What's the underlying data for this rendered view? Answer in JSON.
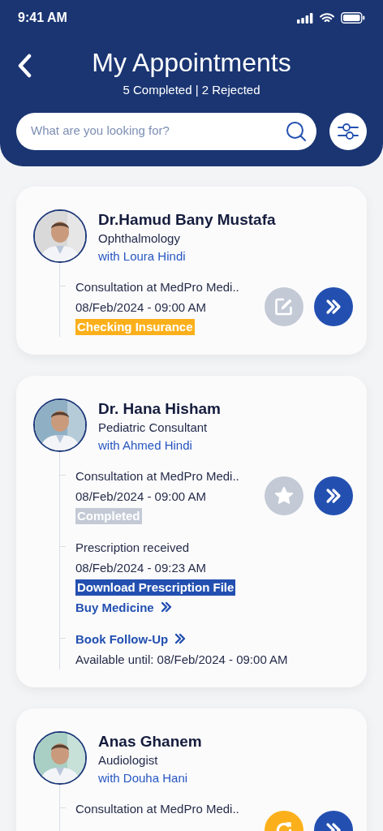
{
  "status_bar": {
    "time": "9:41 AM"
  },
  "header": {
    "title": "My Appointments",
    "subtitle": "5 Completed | 2 Rejected",
    "search": {
      "placeholder": "What are you looking for?"
    }
  },
  "appointments": [
    {
      "doctor": "Dr.Hamud Bany Mustafa",
      "specialty": "Ophthalmology",
      "with": "with Loura Hindi",
      "photo": {
        "kind": "picture"
      },
      "actions": [
        {
          "kind": "edit",
          "color": "#c3cad6"
        },
        {
          "kind": "next",
          "color": "#2350b0"
        }
      ],
      "events": [
        {
          "kind": "visit",
          "place": "Consultation at MedPro Medi..",
          "datetime": "08/Feb/2024 - 09:00 AM",
          "status": {
            "label": "Checking Insurance",
            "color": "#fbb01b"
          }
        }
      ]
    },
    {
      "doctor": "Dr. Hana Hisham",
      "specialty": "Pediatric Consultant",
      "with": "with Ahmed Hindi",
      "photo": {
        "kind": "picture"
      },
      "actions": [
        {
          "kind": "rate",
          "color": "#c3cad6"
        },
        {
          "kind": "next",
          "color": "#2350b0"
        }
      ],
      "events": [
        {
          "kind": "visit",
          "place": "Consultation at MedPro Medi..",
          "datetime": "08/Feb/2024 - 09:00 AM",
          "status": {
            "label": "Completed",
            "color": "#c3cad6"
          }
        },
        {
          "kind": "prescription",
          "title": "Prescription received",
          "datetime": "08/Feb/2024 - 09:23 AM",
          "download": "Download Prescription File",
          "buy": "Buy Medicine"
        },
        {
          "kind": "followup",
          "link": "Book Follow-Up",
          "available": "Available until: 08/Feb/2024 - 09:00 AM"
        }
      ]
    },
    {
      "doctor": "Anas Ghanem",
      "specialty": "Audiologist",
      "with": "with Douha Hani",
      "photo": {
        "kind": "picture"
      },
      "actions": [
        {
          "kind": "reschedule",
          "color": "#fbb01b"
        },
        {
          "kind": "next",
          "color": "#2350b0"
        }
      ],
      "events": [
        {
          "kind": "visit",
          "place": "Consultation at MedPro Medi.."
        }
      ]
    }
  ]
}
